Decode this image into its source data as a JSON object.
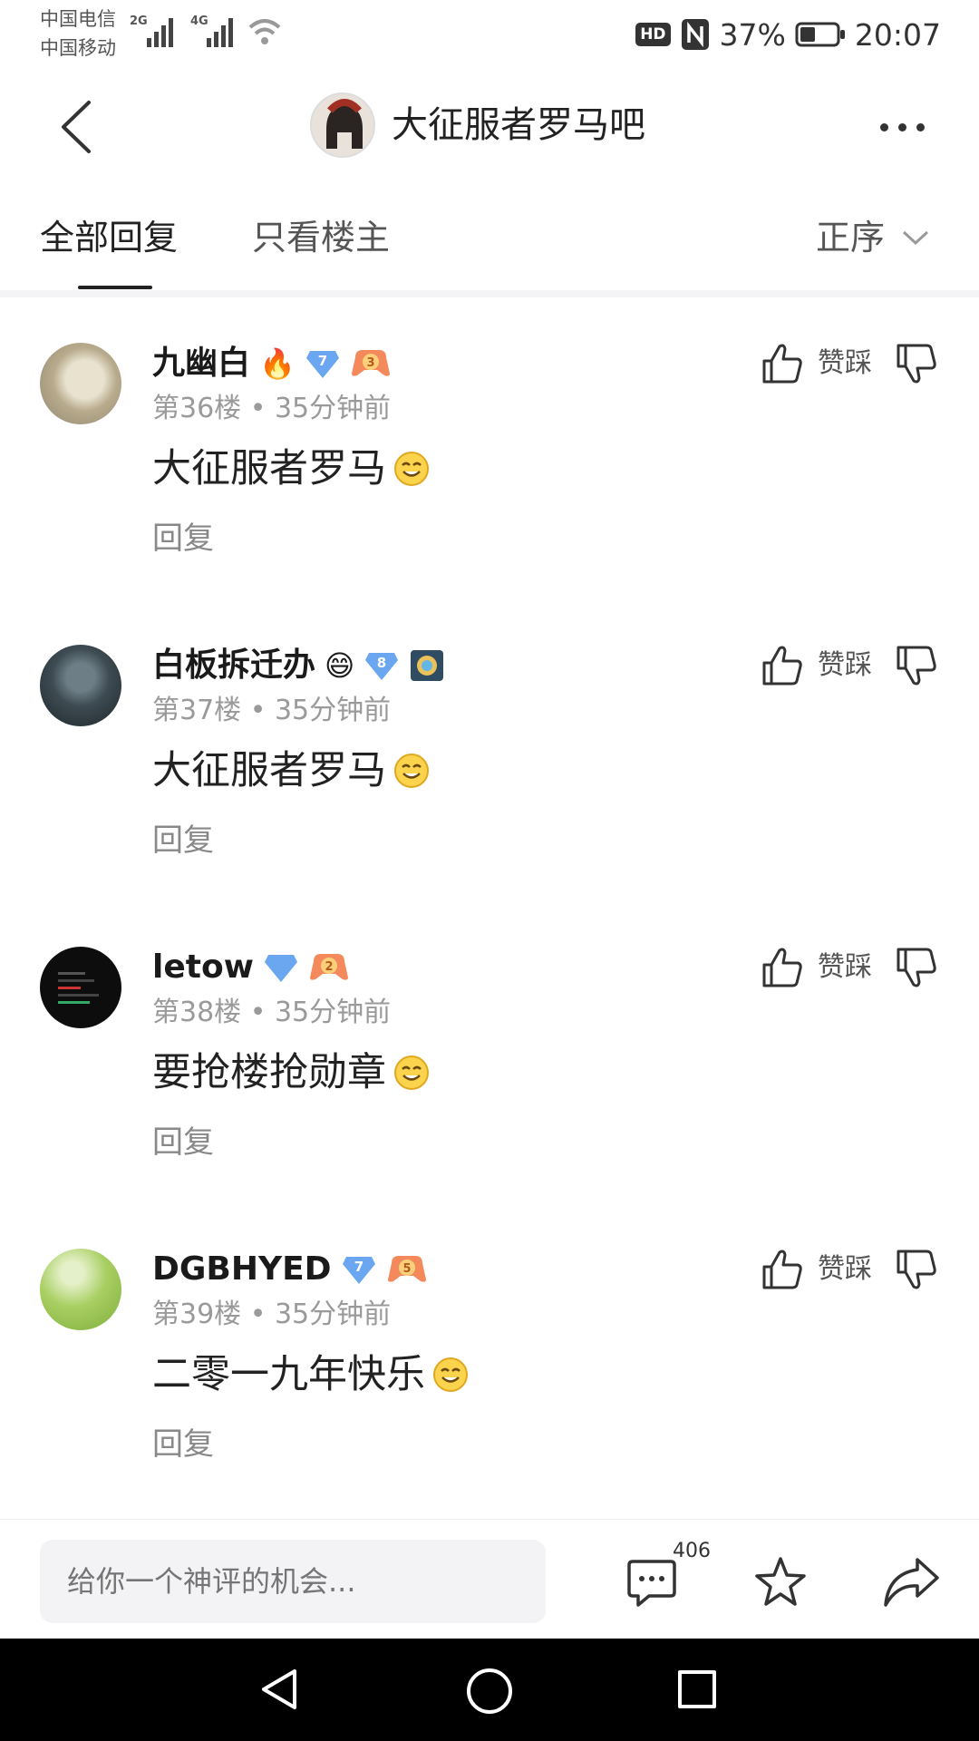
{
  "status_bar": {
    "carrier1": "中国电信",
    "carrier2": "中国移动",
    "net1": "2G",
    "net2": "4G",
    "hd": "HD",
    "nfc": "N",
    "battery": "37%",
    "time": "20:07"
  },
  "header": {
    "forum_name": "大征服者罗马吧"
  },
  "tabs": {
    "all_replies": "全部回复",
    "op_only": "只看楼主",
    "sort": "正序"
  },
  "posts": [
    {
      "username": "九幽白",
      "suffix": "🔥",
      "level": "7",
      "level_color": "#6aa7f0",
      "fan_badge": "3",
      "floor": "第36楼",
      "time": "35分钟前",
      "content": "大征服者罗马",
      "reply_label": "回复",
      "vote_label": "赞踩"
    },
    {
      "username": "白板拆迁办",
      "suffix": "😄",
      "level": "8",
      "level_color": "#6aa7f0",
      "fan_badge": "",
      "floor": "第37楼",
      "time": "35分钟前",
      "content": "大征服者罗马",
      "reply_label": "回复",
      "vote_label": "赞踩"
    },
    {
      "username": "letow",
      "suffix": "",
      "level": "",
      "level_color": "#6aa7f0",
      "fan_badge": "2",
      "floor": "第38楼",
      "time": "35分钟前",
      "content": "要抢楼抢勋章",
      "reply_label": "回复",
      "vote_label": "赞踩"
    },
    {
      "username": "DGBHYED",
      "suffix": "",
      "level": "7",
      "level_color": "#6aa7f0",
      "fan_badge": "5",
      "floor": "第39楼",
      "time": "35分钟前",
      "content": "二零一九年快乐",
      "reply_label": "回复",
      "vote_label": "赞踩"
    }
  ],
  "bottom_bar": {
    "input_placeholder": "给你一个神评的机会...",
    "comment_count": "406"
  },
  "icons": {
    "back": "back-chevron-icon",
    "more": "more-dots-icon",
    "like": "thumbs-up-icon",
    "dislike": "thumbs-down-icon",
    "comment": "comment-bubble-icon",
    "favorite": "star-icon",
    "share": "share-arrow-icon"
  }
}
